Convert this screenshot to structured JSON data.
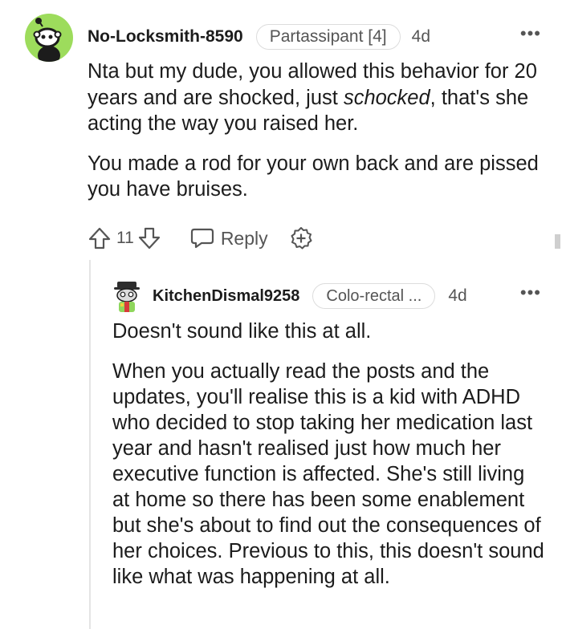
{
  "comment": {
    "username": "No-Locksmith-8590",
    "flair": "Partassipant [4]",
    "age": "4d",
    "more_icon": "more-horizontal-icon",
    "more_label": "•••",
    "body": {
      "p1_a": "Nta but my dude, you allowed this behavior for 20 years and are shocked, just ",
      "p1_em": "schocked",
      "p1_b": ", that's she acting the way you raised her.",
      "p2": "You made a rod for your own back and are pissed you have bruises."
    },
    "actions": {
      "upvote_icon": "upvote-arrow-icon",
      "vote_count": "11",
      "downvote_icon": "downvote-arrow-icon",
      "reply_icon": "speech-bubble-icon",
      "reply_label": "Reply",
      "award_icon": "award-plus-icon"
    },
    "avatar_color": "#9ddc5c"
  },
  "reply": {
    "username": "KitchenDismal9258",
    "flair": "Colo-rectal ...",
    "age": "4d",
    "more_label": "•••",
    "body": {
      "p1": "Doesn't sound like this at all.",
      "p2": "When you actually read the posts and the updates, you'll realise this is a kid with ADHD who decided to stop taking her medication last year and hasn't realised just how much her executive function is affected. She's still living at home so there has been some enablement but she's about to find out the consequences of her choices. Previous to this, this doesn't sound like what was happening at all."
    }
  },
  "colors": {
    "text": "#1c1c1c",
    "muted": "#555555",
    "flair_border": "#dcdcdc",
    "thread_line": "#e4e4e4"
  }
}
